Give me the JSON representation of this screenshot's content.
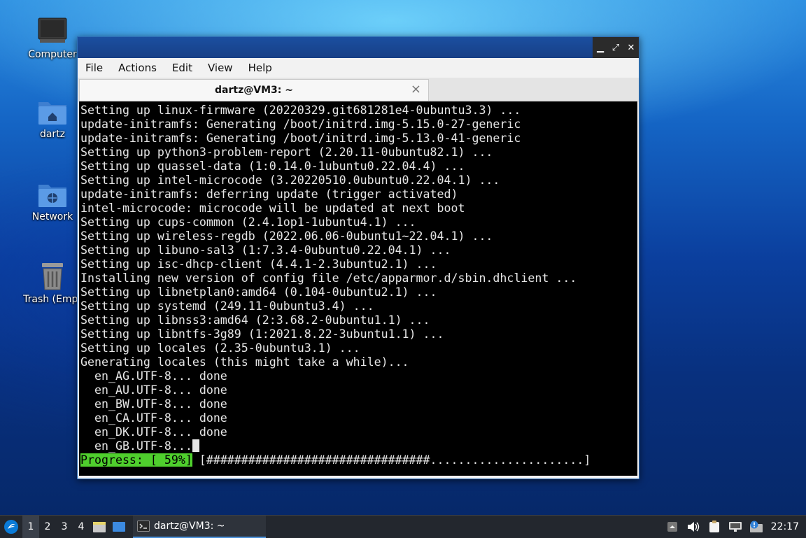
{
  "desktop": {
    "icons": [
      {
        "label": "Computer"
      },
      {
        "label": "dartz"
      },
      {
        "label": "Network"
      },
      {
        "label": "Trash (Empt"
      }
    ]
  },
  "window": {
    "menu": [
      "File",
      "Actions",
      "Edit",
      "View",
      "Help"
    ],
    "tab_title": "dartz@VM3: ~",
    "tab_close": "×",
    "controls": {
      "minimize": "▁",
      "maximize": "⤢",
      "close": "✕"
    }
  },
  "terminal": {
    "lines": [
      "Setting up linux-firmware (20220329.git681281e4-0ubuntu3.3) ...",
      "update-initramfs: Generating /boot/initrd.img-5.15.0-27-generic",
      "update-initramfs: Generating /boot/initrd.img-5.13.0-41-generic",
      "Setting up python3-problem-report (2.20.11-0ubuntu82.1) ...",
      "Setting up quassel-data (1:0.14.0-1ubuntu0.22.04.4) ...",
      "Setting up intel-microcode (3.20220510.0ubuntu0.22.04.1) ...",
      "update-initramfs: deferring update (trigger activated)",
      "intel-microcode: microcode will be updated at next boot",
      "Setting up cups-common (2.4.1op1-1ubuntu4.1) ...",
      "Setting up wireless-regdb (2022.06.06-0ubuntu1~22.04.1) ...",
      "Setting up libuno-sal3 (1:7.3.4-0ubuntu0.22.04.1) ...",
      "Setting up isc-dhcp-client (4.4.1-2.3ubuntu2.1) ...",
      "Installing new version of config file /etc/apparmor.d/sbin.dhclient ...",
      "Setting up libnetplan0:amd64 (0.104-0ubuntu2.1) ...",
      "Setting up systemd (249.11-0ubuntu3.4) ...",
      "Setting up libnss3:amd64 (2:3.68.2-0ubuntu1.1) ...",
      "Setting up libntfs-3g89 (1:2021.8.22-3ubuntu1.1) ...",
      "Setting up locales (2.35-0ubuntu3.1) ...",
      "Generating locales (this might take a while)...",
      "  en_AG.UTF-8... done",
      "  en_AU.UTF-8... done",
      "  en_BW.UTF-8... done",
      "  en_CA.UTF-8... done",
      "  en_DK.UTF-8... done"
    ],
    "current_line": "  en_GB.UTF-8...",
    "progress_label": "Progress: [ 59%]",
    "progress_bar": " [################################......................]",
    "progress_fraction": 0.59
  },
  "taskbar": {
    "workspaces": [
      "1",
      "2",
      "3",
      "4"
    ],
    "active_workspace": "1",
    "task_label": "dartz@VM3: ~",
    "clock": "22:17"
  }
}
